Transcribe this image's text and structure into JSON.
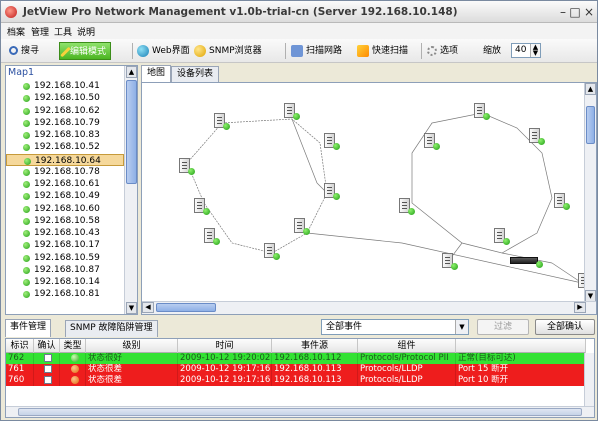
{
  "window": {
    "title": "JetView Pro Network Management v1.0b-trial-cn (Server 192.168.10.148)",
    "min_label": "–",
    "max_label": "□",
    "close_label": "×"
  },
  "menu": [
    "档案",
    "管理",
    "工具",
    "说明"
  ],
  "toolbar": {
    "search": "搜寻",
    "edit_mode": "编辑模式",
    "web": "Web界面",
    "snmp": "SNMP浏览器",
    "scan_subnet": "扫描网路",
    "quick_scan": "快速扫描",
    "options": "选项",
    "zoom_label": "缩放",
    "zoom_value": "40"
  },
  "tree": {
    "root": "Map1",
    "items": [
      "192.168.10.41",
      "192.168.10.50",
      "192.168.10.62",
      "192.168.10.79",
      "192.168.10.83",
      "192.168.10.52",
      "192.168.10.64",
      "192.168.10.78",
      "192.168.10.61",
      "192.168.10.49",
      "192.168.10.60",
      "192.168.10.58",
      "192.168.10.43",
      "192.168.10.17",
      "192.168.10.59",
      "192.168.10.87",
      "192.168.10.14",
      "192.168.10.81"
    ],
    "selected_index": 6
  },
  "map_tabs": [
    "地图",
    "设备列表"
  ],
  "events": {
    "tabs": [
      "事件管理",
      "SNMP 故障陷阱管理"
    ],
    "filter_select": "全部事件",
    "filter_button": "过滤",
    "ack_all_button": "全部确认",
    "columns": [
      "标识",
      "确认",
      "类型",
      "级别",
      "时间",
      "事件源",
      "组件",
      ""
    ],
    "rows": [
      {
        "id": "762",
        "level": "状态很好",
        "time": "2009-10-12 19:20:02",
        "source": "192.168.10.112",
        "component": "Protocols/Protocol PII",
        "desc": "正常(目标可达)",
        "color": "green"
      },
      {
        "id": "761",
        "level": "状态很差",
        "time": "2009-10-12 19:17:16",
        "source": "192.168.10.113",
        "component": "Protocols/LLDP",
        "desc": "Port 15 断开",
        "color": "red"
      },
      {
        "id": "760",
        "level": "状态很差",
        "time": "2009-10-12 19:17:16",
        "source": "192.168.10.113",
        "component": "Protocols/LLDP",
        "desc": "Port 10 断开",
        "color": "red"
      }
    ]
  },
  "colors": {
    "selected_tree": "#f5d89b",
    "ok_row": "#33e233",
    "bad_row": "#ee1d1d",
    "accent_green": "#4cb522"
  },
  "icons": {
    "app": "jetview-logo-icon",
    "search": "magnifier-icon",
    "edit": "pencil-icon",
    "web": "globe-icon",
    "snmp": "snmp-icon",
    "scan": "scan-icon",
    "quick": "lightning-icon",
    "options": "gear-icon"
  }
}
